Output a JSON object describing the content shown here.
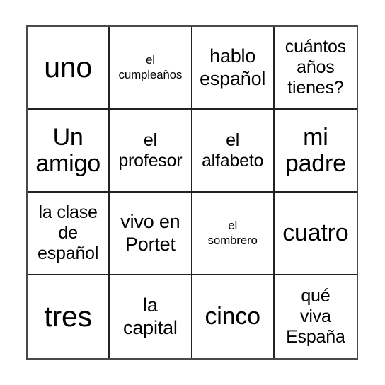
{
  "card": {
    "type": "bingo-card",
    "rows": 4,
    "columns": 4,
    "colors": {
      "background": "#ffffff",
      "outer_border": "#4a4a4a",
      "grid_line": "#222222",
      "text": "#000000"
    },
    "cells": [
      {
        "text": "uno",
        "size": "xl"
      },
      {
        "text": "el\ncumpleaños",
        "size": "xs"
      },
      {
        "text": "hablo\nespañol",
        "size": "md"
      },
      {
        "text": "cuántos\naños\ntienes?",
        "size": "sm"
      },
      {
        "text": "Un\namigo",
        "size": "lg"
      },
      {
        "text": "el\nprofesor",
        "size": "sm"
      },
      {
        "text": "el\nalfabeto",
        "size": "sm"
      },
      {
        "text": "mi\npadre",
        "size": "lg"
      },
      {
        "text": "la clase\nde\nespañol",
        "size": "sm"
      },
      {
        "text": "vivo en\nPortet",
        "size": "md"
      },
      {
        "text": "el\nsombrero",
        "size": "xs"
      },
      {
        "text": "cuatro",
        "size": "lg"
      },
      {
        "text": "tres",
        "size": "xl"
      },
      {
        "text": "la\ncapital",
        "size": "md"
      },
      {
        "text": "cinco",
        "size": "lg"
      },
      {
        "text": "qué\nviva\nEspaña",
        "size": "sm"
      }
    ]
  }
}
